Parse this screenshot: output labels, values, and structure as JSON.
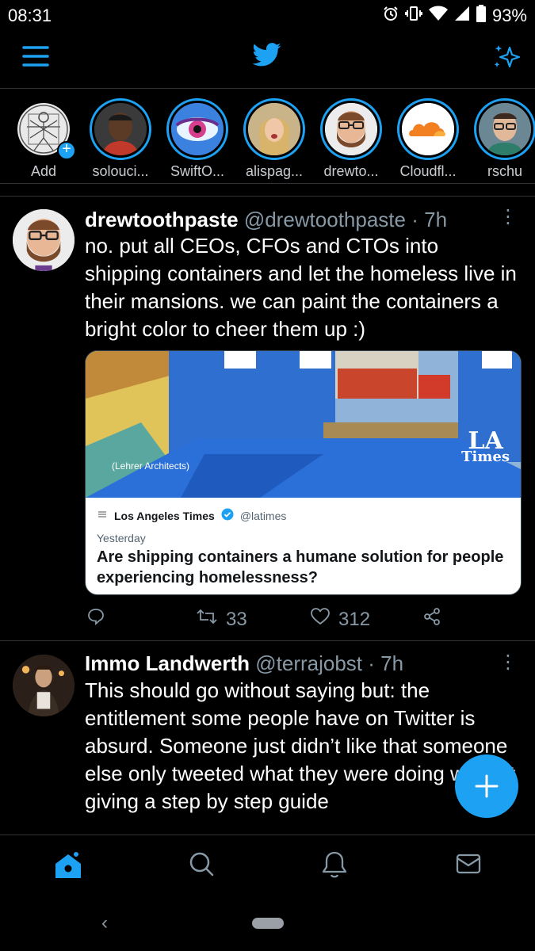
{
  "status_bar": {
    "time": "08:31",
    "battery": "93%"
  },
  "fleets": [
    {
      "name": "Add",
      "has_add": true
    },
    {
      "name": "solouci..."
    },
    {
      "name": "SwiftO..."
    },
    {
      "name": "alispag..."
    },
    {
      "name": "drewto..."
    },
    {
      "name": "Cloudfl..."
    },
    {
      "name": "rschu"
    }
  ],
  "tweets": [
    {
      "display_name": "drewtoothpaste",
      "handle": "@drewtoothpaste",
      "time": "7h",
      "text": "no. put all CEOs, CFOs and CTOs into shipping containers and let the homeless live in their mansions. we can paint the containers a bright color to cheer them up :)",
      "card": {
        "photo_caption": "(Lehrer Architects)",
        "photo_logo_line1": "LA",
        "photo_logo_line2": "Times",
        "source_name": "Los Angeles Times",
        "source_handle": "@latimes",
        "date": "Yesterday",
        "title": "Are shipping containers a humane solution for people experiencing homelessness?"
      },
      "actions": {
        "retweets": "33",
        "likes": "312"
      }
    },
    {
      "display_name": "Immo Landwerth",
      "handle": "@terrajobst",
      "time": "7h",
      "text": "This should go without saying but: the entitlement some people have on Twitter is absurd. Someone just didn’t like that someone else only tweeted what they were doing without giving a step by step guide"
    }
  ],
  "colors": {
    "accent": "#1da1f2",
    "background": "#000000",
    "muted": "#8899a6",
    "divider": "#2f3336"
  }
}
